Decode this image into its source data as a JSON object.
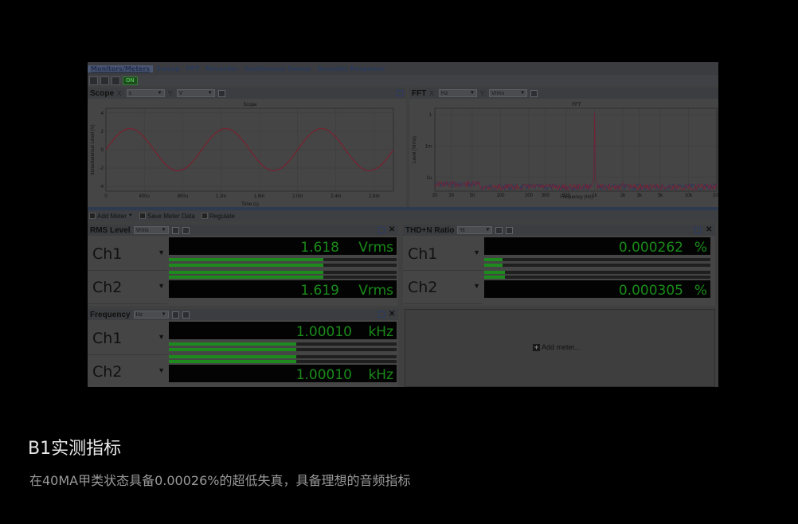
{
  "app": {
    "menu": [
      "Monitors/Meters",
      "Sweep",
      "FFT",
      "Recorder",
      "Continuous Sweep",
      "Acoustic Response"
    ],
    "toolbar": {
      "on_label": "ON"
    }
  },
  "scope": {
    "title": "Scope",
    "x_label": "X:",
    "x_unit": "s",
    "y_label": "Y:",
    "y_unit": "V",
    "chart_title": "Scope"
  },
  "fft": {
    "title": "FFT",
    "x_label": "X:",
    "x_unit": "Hz",
    "y_label": "Y:",
    "y_unit": "Vrms",
    "chart_title": "FFT"
  },
  "meter_toolbar": {
    "add_meter": "Add Meter",
    "save_meter_data": "Save Meter Data",
    "regulate": "Regulate"
  },
  "rms": {
    "title": "RMS Level",
    "unit_select": "Vrms",
    "ch1": {
      "name": "Ch1",
      "value": "1.618",
      "unit": "Vrms",
      "level": 0.68
    },
    "ch2": {
      "name": "Ch2",
      "value": "1.619",
      "unit": "Vrms",
      "level": 0.68
    }
  },
  "thdn": {
    "title": "THD+N Ratio",
    "unit_select": "%",
    "ch1": {
      "name": "Ch1",
      "value": "0.000262",
      "unit": "%",
      "level": 0.08
    },
    "ch2": {
      "name": "Ch2",
      "value": "0.000305",
      "unit": "%",
      "level": 0.09
    }
  },
  "freq": {
    "title": "Frequency",
    "unit_select": "Hz",
    "ch1": {
      "name": "Ch1",
      "value": "1.00010",
      "unit": "kHz",
      "level": 0.56
    },
    "ch2": {
      "name": "Ch2",
      "value": "1.00010",
      "unit": "kHz",
      "level": 0.56
    }
  },
  "add_meter_area": {
    "label": "Add meter..."
  },
  "caption": {
    "title": "B1实测指标",
    "subtitle": "在40MA甲类状态具备0.00026%的超低失真，具备理想的音频指标"
  },
  "chart_data": [
    {
      "type": "line",
      "title": "Scope",
      "xlabel": "Time (s)",
      "ylabel": "Instantaneous Level (V)",
      "x_ticks": [
        "0",
        "400u",
        "800u",
        "1.2m",
        "1.6m",
        "2.0m",
        "2.4m",
        "2.8m"
      ],
      "y_ticks": [
        "4",
        "2",
        "0",
        "-2",
        "-4"
      ],
      "xlim": [
        0,
        0.003
      ],
      "ylim": [
        -4.5,
        4.5
      ],
      "series": [
        {
          "amplitude": 2.29,
          "frequency": 1000,
          "color": "#7a2030"
        }
      ],
      "grid": true
    },
    {
      "type": "line",
      "title": "FFT",
      "xlabel": "Frequency (Hz)",
      "ylabel": "Level (Vrms)",
      "x_ticks": [
        "20",
        "30",
        "50",
        "100",
        "200",
        "300",
        "500",
        "1k",
        "2k",
        "3k",
        "5k",
        "10k",
        "20k"
      ],
      "y_ticks": [
        "1",
        "1m",
        "1u"
      ],
      "xlim": [
        20,
        20000
      ],
      "x_scale": "log",
      "y_scale": "log",
      "peaks": [
        {
          "freq": 1000,
          "level": 1.6
        },
        {
          "freq": 2000,
          "level": 3e-07
        },
        {
          "freq": 3000,
          "level": 2e-07
        }
      ],
      "series_colors": [
        "#7a2030",
        "#2a3560"
      ],
      "grid": true
    }
  ]
}
